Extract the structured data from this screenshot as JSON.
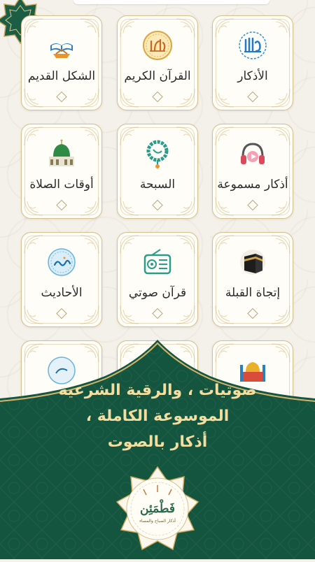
{
  "colors": {
    "background": "#f4f1ea",
    "card_border": "#d6c08f",
    "banner_green": "#14553f",
    "banner_text": "#f3dea0",
    "gold": "#c9a75c"
  },
  "grid": {
    "rows": [
      [
        {
          "label": "الأذكار",
          "icon": "allah-calligraphy-icon"
        },
        {
          "label": "القرآن الكريم",
          "icon": "quran-calligraphy-icon"
        },
        {
          "label": "الشكل القديم",
          "icon": "open-quran-book-icon"
        }
      ],
      [
        {
          "label": "أذكار مسموعة",
          "icon": "headphones-icon"
        },
        {
          "label": "السبحة",
          "icon": "prayer-beads-icon"
        },
        {
          "label": "أوقات الصلاة",
          "icon": "mosque-dome-icon"
        }
      ],
      [
        {
          "label": "إتجاة القبلة",
          "icon": "kaaba-icon"
        },
        {
          "label": "قرآن صوتي",
          "icon": "radio-icon"
        },
        {
          "label": "الأحاديث",
          "icon": "muhammad-calligraphy-icon"
        }
      ]
    ]
  },
  "banner": {
    "line1": "صوتيات ، والرقية الشرعية",
    "line2": "الموسوعة الكاملة ،",
    "line3": "أذكار بالصوت"
  },
  "logo": {
    "title": "فَطْمَئِن",
    "subtitle": "أذكار الصباح والمساء"
  }
}
